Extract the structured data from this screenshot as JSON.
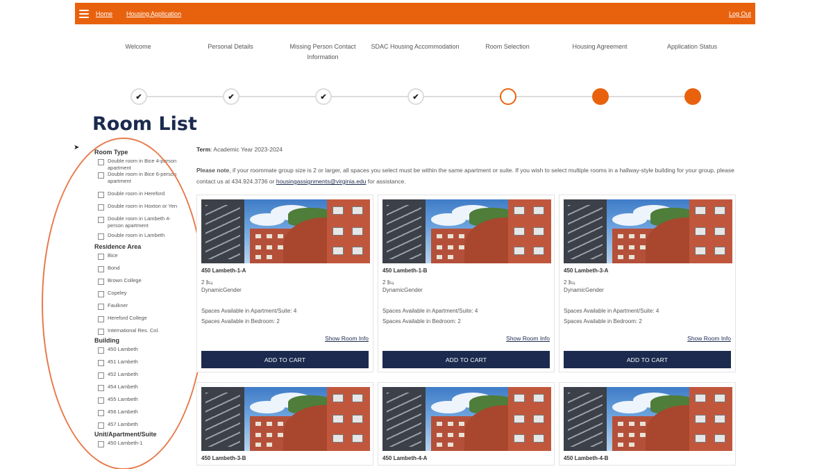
{
  "nav": {
    "home": "Home",
    "housing_application": "Housing Application",
    "logout": "Log Out"
  },
  "steps": [
    {
      "label": "Welcome",
      "status": "complete"
    },
    {
      "label": "Personal Details",
      "status": "complete"
    },
    {
      "label": "Missing Person Contact Information",
      "status": "complete"
    },
    {
      "label": "SDAC Housing Accommodation",
      "status": "complete"
    },
    {
      "label": "Room Selection",
      "status": "current"
    },
    {
      "label": "Housing Agreement",
      "status": "incomplete"
    },
    {
      "label": "Application Status",
      "status": "incomplete"
    }
  ],
  "page_title": "Room List",
  "filters": {
    "room_type": {
      "heading": "Room Type",
      "items": [
        "Double room in Bice 4-person apartment",
        "Double room in Bice 6-person apartment",
        "Double room in Hereford",
        "Double room in Hoxton or Yen",
        "Double room in Lambeth 4-person apartment",
        "Double room in Lambeth"
      ]
    },
    "residence_area": {
      "heading": "Residence Area",
      "items": [
        "Bice",
        "Bond",
        "Brown College",
        "Copeley",
        "Faulkner",
        "Hereford College",
        "International Res. Col."
      ]
    },
    "building": {
      "heading": "Building",
      "items": [
        "450 Lambeth",
        "451 Lambeth",
        "452 Lambeth",
        "454 Lambeth",
        "455 Lambeth",
        "456 Lambeth",
        "457 Lambeth"
      ]
    },
    "unit": {
      "heading": "Unit/Apartment/Suite",
      "items": [
        "450 Lambeth-1"
      ]
    }
  },
  "term": {
    "label": "Term",
    "value": ": Academic Year 2023-2024"
  },
  "note": {
    "bold": "Please note",
    "text1": ", if your roommate group size is 2 or larger, all spaces you select must be within the same apartment or suite. If you wish to select multiple rooms in a hallway-style building for your group, please contact us at 434.924.3736 or ",
    "email": "housingassignments@virginia.edu",
    "text2": " for assistance."
  },
  "rooms": [
    {
      "name": "450 Lambeth-1-A",
      "beds": "2",
      "gender": "DynamicGender",
      "apt_spaces": "Spaces Available in Apartment/Suite: 4",
      "bed_spaces": "Spaces Available in Bedroom: 2",
      "show_info": "Show Room Info",
      "add": "ADD TO CART"
    },
    {
      "name": "450 Lambeth-1-B",
      "beds": "2",
      "gender": "DynamicGender",
      "apt_spaces": "Spaces Available in Apartment/Suite: 4",
      "bed_spaces": "Spaces Available in Bedroom: 2",
      "show_info": "Show Room Info",
      "add": "ADD TO CART"
    },
    {
      "name": "450 Lambeth-3-A",
      "beds": "2",
      "gender": "DynamicGender",
      "apt_spaces": "Spaces Available in Apartment/Suite: 4",
      "bed_spaces": "Spaces Available in Bedroom: 2",
      "show_info": "Show Room Info",
      "add": "ADD TO CART"
    },
    {
      "name": "450 Lambeth-3-B"
    },
    {
      "name": "450 Lambeth-4-A"
    },
    {
      "name": "450 Lambeth-4-B"
    }
  ],
  "colors": {
    "accent": "#e8620e",
    "navy": "#1b2a4e"
  }
}
